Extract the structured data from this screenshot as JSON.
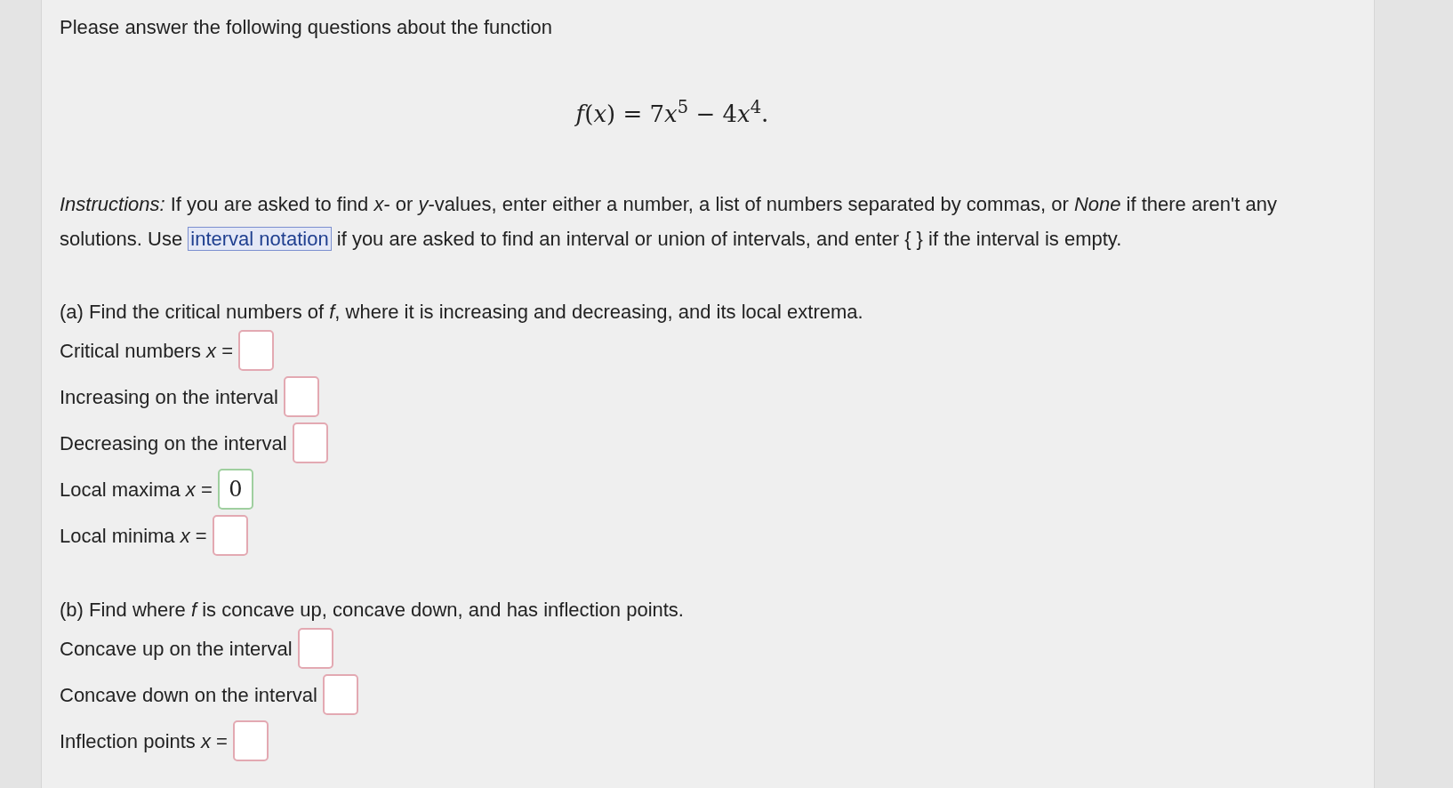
{
  "intro": "Please answer the following questions about the function",
  "formula": [
    {
      "kind": "var",
      "text": "f"
    },
    {
      "kind": "text",
      "text": "("
    },
    {
      "kind": "var",
      "text": "x"
    },
    {
      "kind": "text",
      "text": ") = 7"
    },
    {
      "kind": "var",
      "text": "x"
    },
    {
      "kind": "sup",
      "text": "5"
    },
    {
      "kind": "text",
      "text": " − 4"
    },
    {
      "kind": "var",
      "text": "x"
    },
    {
      "kind": "sup",
      "text": "4"
    },
    {
      "kind": "text",
      "text": "."
    }
  ],
  "instructions": {
    "before": "*Instructions:* If you are asked to find *x*- or *y*-values, enter either a number, a list of numbers separated by commas, or *None* if there aren't any solutions. Use",
    "link": "interval notation",
    "after": "if you are asked to find an interval or union of intervals, and enter { } if the interval is empty."
  },
  "parts": [
    {
      "heading": "(a) Find the critical numbers of *f*, where it is increasing and decreasing, and its local extrema.",
      "fields": [
        {
          "label": "Critical numbers *x* =",
          "correct": false
        },
        {
          "label": "Increasing on the interval",
          "correct": false
        },
        {
          "label": "Decreasing on the interval",
          "correct": false
        },
        {
          "label": "Local maxima *x* =",
          "value": "0",
          "correct": true
        },
        {
          "label": "Local minima *x* =",
          "correct": false
        }
      ]
    },
    {
      "heading": "(b) Find where *f* is concave up, concave down, and has inflection points.",
      "fields": [
        {
          "label": "Concave up on the interval",
          "correct": false
        },
        {
          "label": "Concave down on the interval",
          "correct": false
        },
        {
          "label": "Inflection points *x* =",
          "correct": false
        }
      ]
    }
  ]
}
